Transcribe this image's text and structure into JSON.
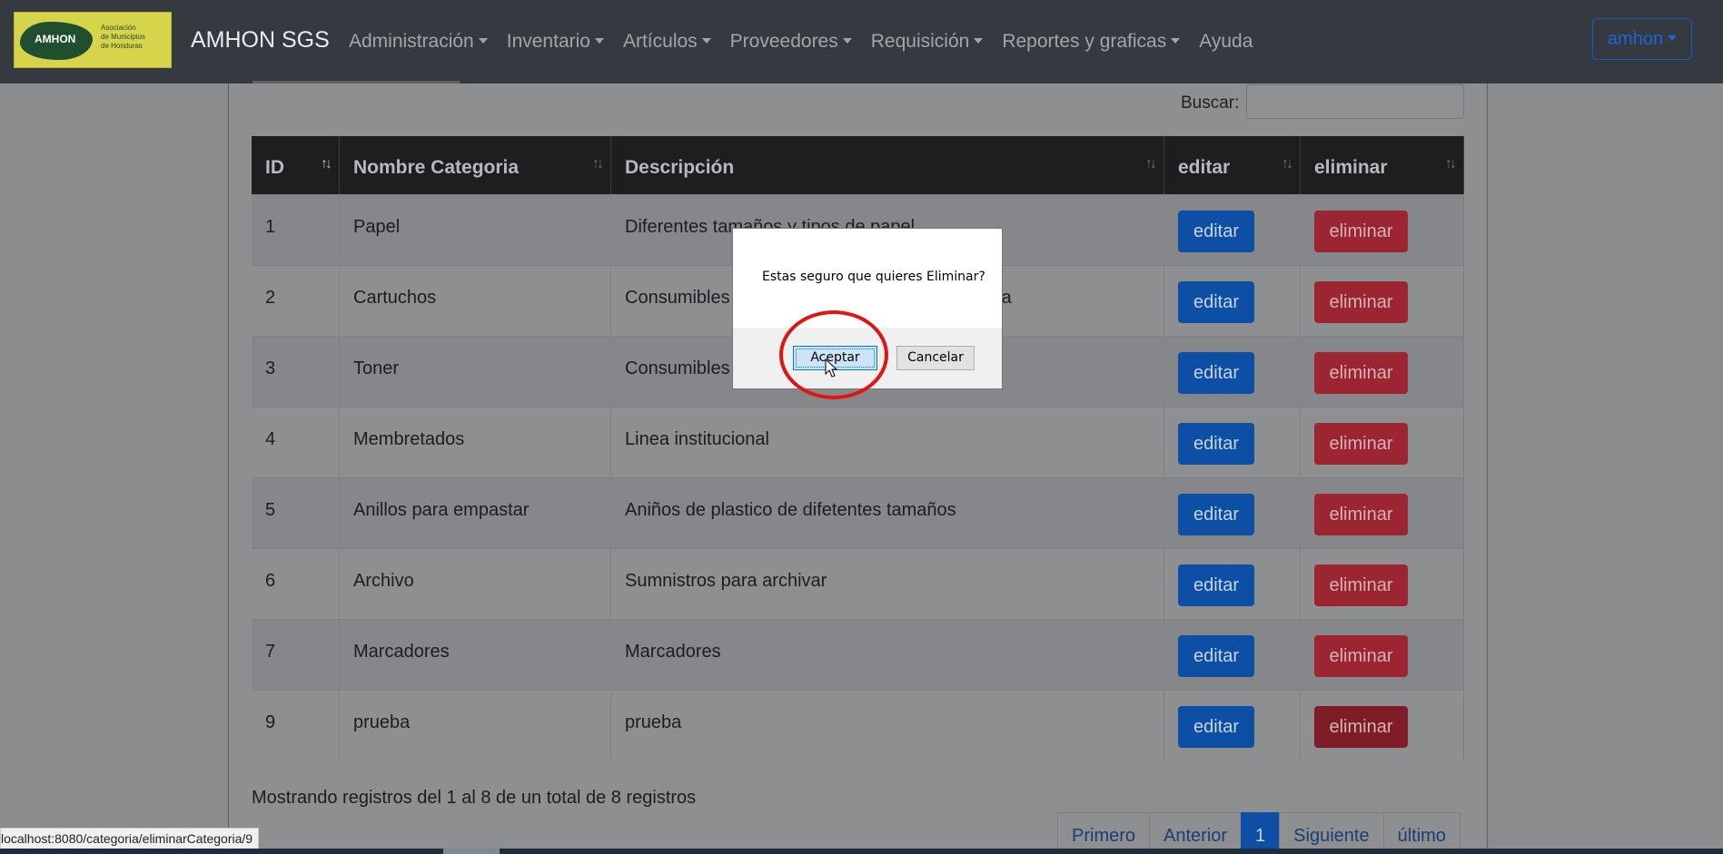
{
  "navbar": {
    "logo": {
      "abbr": "AMHON",
      "tagline_lines": [
        "Asociación",
        "de Municipios",
        "de Honduras"
      ]
    },
    "brand": "AMHON SGS",
    "menu": [
      {
        "label": "Administración",
        "dropdown": true
      },
      {
        "label": "Inventario",
        "dropdown": true
      },
      {
        "label": "Artículos",
        "dropdown": true
      },
      {
        "label": "Proveedores",
        "dropdown": true
      },
      {
        "label": "Requisición",
        "dropdown": true
      },
      {
        "label": "Reportes y graficas",
        "dropdown": true
      },
      {
        "label": "Ayuda",
        "dropdown": false
      }
    ],
    "user": "amhon"
  },
  "search": {
    "label": "Buscar:",
    "value": ""
  },
  "table": {
    "headers": [
      "ID",
      "Nombre Categoria",
      "Descripción",
      "editar",
      "eliminar"
    ],
    "rows": [
      {
        "id": "1",
        "name": "Papel",
        "desc": "Diferentes tamaños y tipos de papel"
      },
      {
        "id": "2",
        "name": "Cartuchos",
        "desc": "Consumibles de impresora de inyección de tinta"
      },
      {
        "id": "3",
        "name": "Toner",
        "desc": "Consumibles de impresora láser"
      },
      {
        "id": "4",
        "name": "Membretados",
        "desc": "Linea institucional"
      },
      {
        "id": "5",
        "name": "Anillos para empastar",
        "desc": "Aniños de plastico de difetentes tamaños"
      },
      {
        "id": "6",
        "name": "Archivo",
        "desc": "Sumnistros para archivar"
      },
      {
        "id": "7",
        "name": "Marcadores",
        "desc": "Marcadores"
      },
      {
        "id": "9",
        "name": "prueba",
        "desc": "prueba"
      }
    ],
    "edit_label": "editar",
    "delete_label": "eliminar"
  },
  "info": "Mostrando registros del 1 al 8 de un total de 8 registros",
  "pagination": {
    "first": "Primero",
    "prev": "Anterior",
    "current": "1",
    "next": "Siguiente",
    "last": "último"
  },
  "status_url": "localhost:8080/categoria/eliminarCategoria/9",
  "dialog": {
    "message": "Estas seguro que quieres Eliminar?",
    "ok": "Aceptar",
    "cancel": "Cancelar"
  },
  "colors": {
    "navbar": "#343a40",
    "primary": "#0c4fa5",
    "danger": "#9b2530",
    "highlight": "#e11414"
  }
}
